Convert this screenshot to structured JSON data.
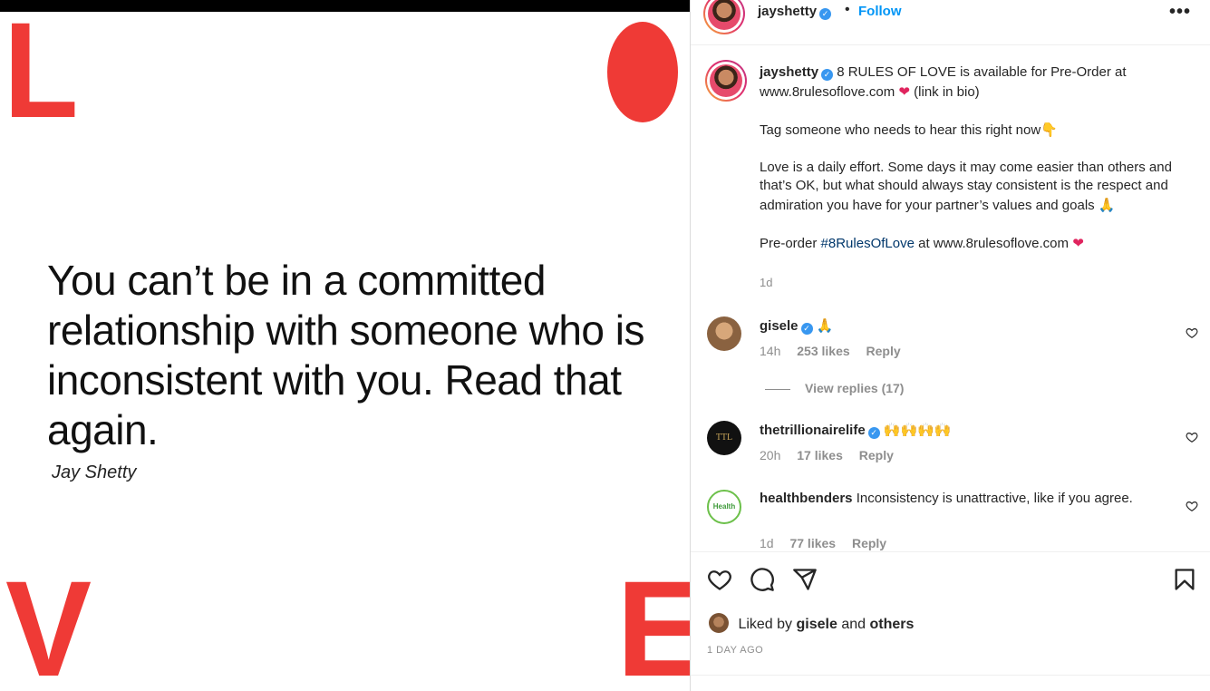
{
  "image": {
    "letters": {
      "top_left": "L",
      "bottom_left": "V",
      "bottom_right": "E"
    },
    "quote": "You can’t be in a committed relationship with someone who is inconsistent with you. Read that again.",
    "author": "Jay Shetty",
    "accent_color": "#ef3a36"
  },
  "header": {
    "username": "jayshetty",
    "dot": "•",
    "follow_label": "Follow",
    "more_icon": "•••"
  },
  "caption": {
    "username": "jayshetty",
    "line1": "8 RULES OF LOVE is available for Pre-Order at www.8rulesoflove.com",
    "line1_tail": "(link in bio)",
    "para2": "Tag someone who needs to hear this right now",
    "para3": "Love is a daily effort. Some days it may come easier than others and that’s OK, but what should always stay consistent is the respect and admiration you have for your partner’s values and goals",
    "para4_prefix": "Pre-order",
    "hashtag": "#8RulesOfLove",
    "para4_suffix": "at www.8rulesoflove.com",
    "time": "1d"
  },
  "comments": [
    {
      "username": "gisele",
      "text": "",
      "emoji": "🙏",
      "time": "14h",
      "likes": "253 likes",
      "reply": "Reply"
    },
    {
      "username": "thetrillionairelife",
      "text": "",
      "emoji": "🙌🙌🙌🙌",
      "time": "20h",
      "likes": "17 likes",
      "reply": "Reply"
    },
    {
      "username": "healthbenders",
      "text": "Inconsistency is unattractive, like if you agree.",
      "emoji": "",
      "time": "1d",
      "likes": "77 likes",
      "reply": "Reply"
    }
  ],
  "view_replies": "View replies (17)",
  "liked_by": {
    "prefix": "Liked by",
    "user": "gisele",
    "middle": "and",
    "others": "others"
  },
  "time_ago": "1 DAY AGO",
  "icons": [
    "heart-icon",
    "comment-icon",
    "share-icon",
    "bookmark-icon"
  ]
}
